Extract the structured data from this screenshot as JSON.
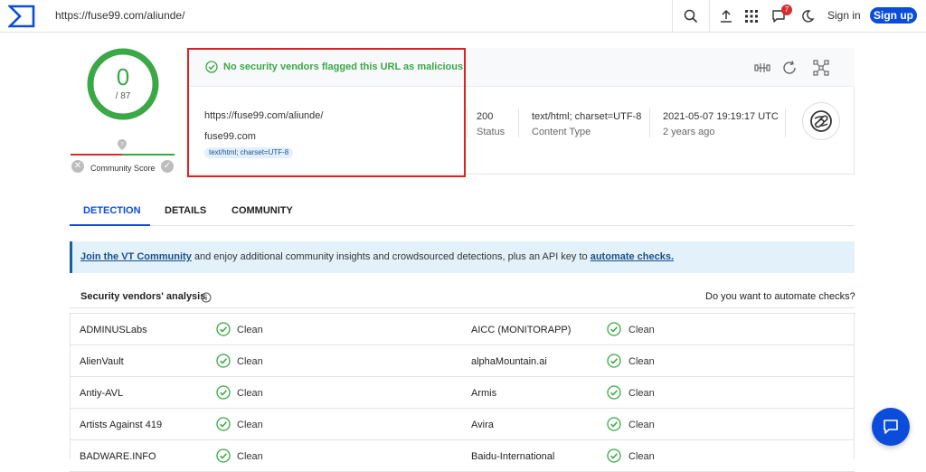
{
  "topbar": {
    "url": "https://fuse99.com/aliunde/",
    "notif_count": "7",
    "signin": "Sign in",
    "signup": "Sign up",
    "icons": [
      "search-icon",
      "upload-icon",
      "apps-grid-icon",
      "notifications-icon",
      "dark-mode-icon"
    ]
  },
  "score": {
    "value": "0",
    "total": "/ 87",
    "community_label": "Community Score"
  },
  "summary": {
    "banner": "No security vendors flagged this URL as malicious",
    "url": "https://fuse99.com/aliunde/",
    "domain": "fuse99.com",
    "tag": "text/html; charset=UTF-8",
    "status_value": "200",
    "status_label": "Status",
    "content_type_value": "text/html; charset=UTF-8",
    "content_type_label": "Content Type",
    "date_value": "2021-05-07 19:19:17 UTC",
    "date_relative": "2 years ago"
  },
  "tabs": [
    "DETECTION",
    "DETAILS",
    "COMMUNITY"
  ],
  "info_banner": {
    "link1": "Join the VT Community",
    "middle": " and enjoy additional community insights and crowdsourced detections, plus an API key to ",
    "link2": "automate checks."
  },
  "vendors_section": {
    "title": "Security vendors' analysis",
    "right": "Do you want to automate checks?"
  },
  "vendors": [
    {
      "left": "ADMINUSLabs",
      "left_result": "Clean",
      "right": "AICC (MONITORAPP)",
      "right_result": "Clean"
    },
    {
      "left": "AlienVault",
      "left_result": "Clean",
      "right": "alphaMountain.ai",
      "right_result": "Clean"
    },
    {
      "left": "Antiy-AVL",
      "left_result": "Clean",
      "right": "Armis",
      "right_result": "Clean"
    },
    {
      "left": "Artists Against 419",
      "left_result": "Clean",
      "right": "Avira",
      "right_result": "Clean"
    },
    {
      "left": "BADWARE.INFO",
      "left_result": "Clean",
      "right": "Baidu-International",
      "right_result": "Clean"
    }
  ],
  "colors": {
    "accent": "#0b4dda",
    "clean_green": "#39a845",
    "highlight_red": "#e02020"
  }
}
